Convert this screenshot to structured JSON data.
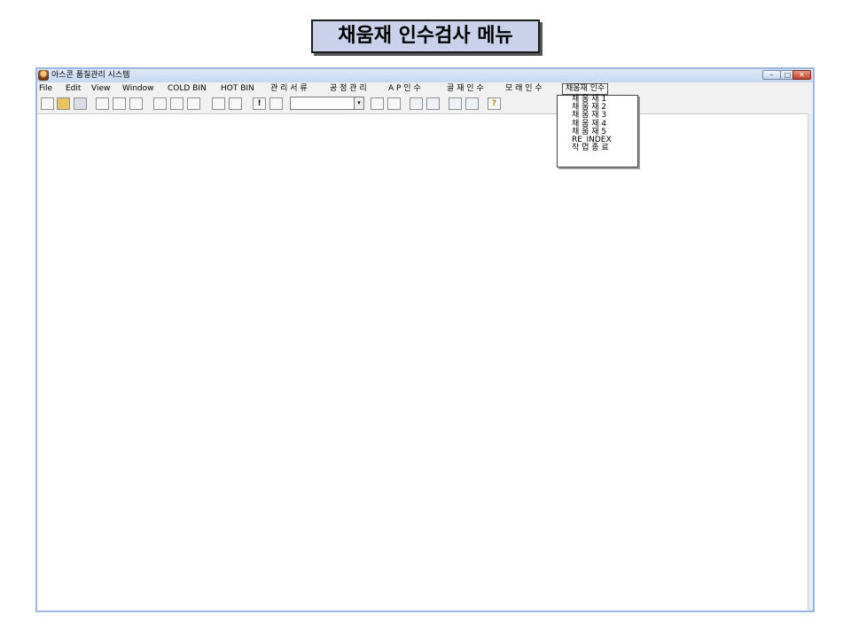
{
  "slide": {
    "title": "채움재 인수검사 메뉴"
  },
  "window": {
    "title": "아스콘 품질관리 시스템",
    "controls": {
      "minimize": "–",
      "maximize": "□",
      "close": "✕"
    }
  },
  "menubar": {
    "items": [
      {
        "label": "File"
      },
      {
        "label": "Edit"
      },
      {
        "label": "View"
      },
      {
        "label": "Window"
      },
      {
        "label": "COLD BIN"
      },
      {
        "label": "HOT BIN"
      },
      {
        "label": "관 리 서 류"
      },
      {
        "label": "공 정 관 리"
      },
      {
        "label": "A P  인 수"
      },
      {
        "label": "골 재  인 수"
      },
      {
        "label": "모 래  인 수"
      },
      {
        "label": "채움재 인수"
      }
    ]
  },
  "toolbar": {
    "icons": [
      "new-icon",
      "open-folder-icon",
      "save-icon",
      "print-icon",
      "print-preview-icon",
      "spell-check-icon",
      "cut-icon",
      "copy-icon",
      "paste-icon",
      "undo-icon",
      "redo-icon",
      "exclamation-icon",
      "chart-icon",
      "table-icon",
      "table-edit-icon",
      "library-icon",
      "library-open-icon",
      "book-icon",
      "book-edit-icon",
      "help-icon"
    ],
    "glyphs": {
      "exclamation": "!",
      "help": "?",
      "combo_arrow": "▾"
    }
  },
  "dropdown": {
    "items": [
      {
        "label": "채  움  재 1"
      },
      {
        "label": "채  움  재 2"
      },
      {
        "label": "채  움  재 3"
      },
      {
        "label": "채  움  재 4"
      },
      {
        "label": "채  움  재 5"
      },
      {
        "label": "RE_INDEX"
      },
      {
        "label": "작 업 종 료"
      }
    ]
  }
}
